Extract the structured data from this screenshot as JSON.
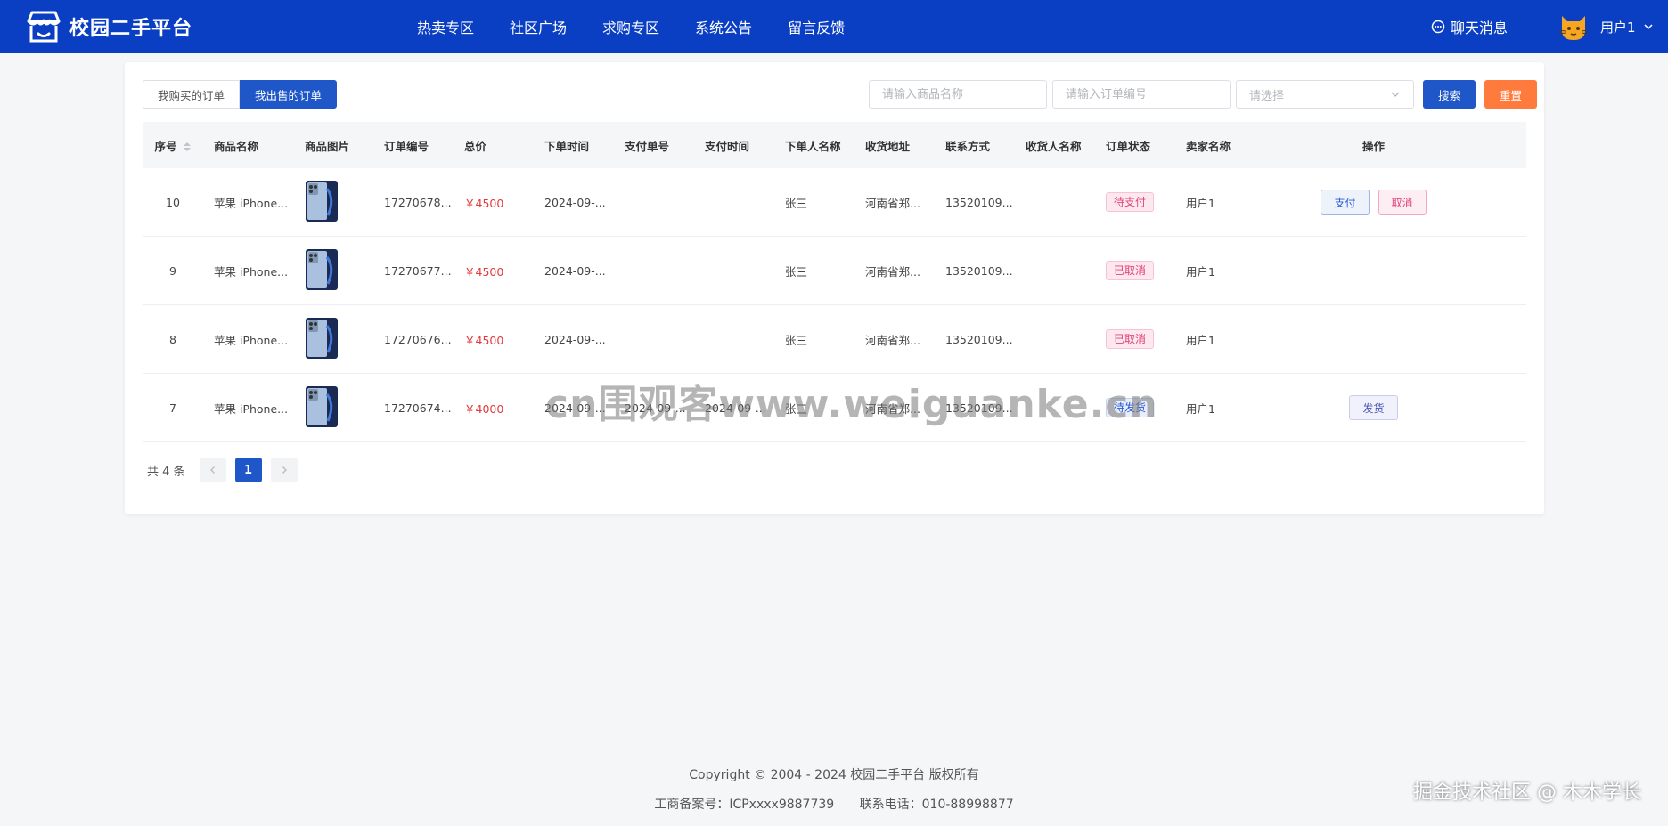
{
  "header": {
    "brand": "校园二手平台",
    "nav": [
      "热卖专区",
      "社区广场",
      "求购专区",
      "系统公告",
      "留言反馈"
    ],
    "chat_label": "聊天消息",
    "user_name": "用户1"
  },
  "tabs": [
    {
      "label": "我购买的订单",
      "active": false
    },
    {
      "label": "我出售的订单",
      "active": true
    }
  ],
  "filters": {
    "product_placeholder": "请输入商品名称",
    "order_placeholder": "请输入订单编号",
    "status_placeholder": "请选择",
    "search_label": "搜索",
    "reset_label": "重置"
  },
  "table": {
    "columns": [
      "序号",
      "商品名称",
      "商品图片",
      "订单编号",
      "总价",
      "下单时间",
      "支付单号",
      "支付时间",
      "下单人名称",
      "收货地址",
      "联系方式",
      "收货人名称",
      "订单状态",
      "卖家名称",
      "操作"
    ],
    "rows": [
      {
        "no": "10",
        "name": "苹果 iPhone...",
        "order_no": "17270678...",
        "price": "￥4500",
        "order_time": "2024-09-...",
        "pay_no": "",
        "pay_time": "",
        "buyer": "张三",
        "address": "河南省郑...",
        "phone": "13520109...",
        "receiver": "",
        "status": "待支付",
        "status_color": "pink",
        "seller": "用户1",
        "actions": [
          "支付",
          "取消"
        ]
      },
      {
        "no": "9",
        "name": "苹果 iPhone...",
        "order_no": "17270677...",
        "price": "￥4500",
        "order_time": "2024-09-...",
        "pay_no": "",
        "pay_time": "",
        "buyer": "张三",
        "address": "河南省郑...",
        "phone": "13520109...",
        "receiver": "",
        "status": "已取消",
        "status_color": "pink",
        "seller": "用户1",
        "actions": []
      },
      {
        "no": "8",
        "name": "苹果 iPhone...",
        "order_no": "17270676...",
        "price": "￥4500",
        "order_time": "2024-09-...",
        "pay_no": "",
        "pay_time": "",
        "buyer": "张三",
        "address": "河南省郑...",
        "phone": "13520109...",
        "receiver": "",
        "status": "已取消",
        "status_color": "pink",
        "seller": "用户1",
        "actions": []
      },
      {
        "no": "7",
        "name": "苹果 iPhone...",
        "order_no": "17270674...",
        "price": "￥4000",
        "order_time": "2024-09-...",
        "pay_no": "2024-09-...",
        "pay_time": "2024-09-...",
        "buyer": "张三",
        "address": "河南省郑...",
        "phone": "13520109...",
        "receiver": "",
        "status": "待发货",
        "status_color": "blue",
        "seller": "用户1",
        "actions": [
          "发货"
        ]
      }
    ]
  },
  "pagination": {
    "total_label": "共 4 条",
    "current_page": "1"
  },
  "watermark": "cn围观客www.weiguanke.cn",
  "footer": {
    "copyright": "Copyright © 2004 - 2024 校园二手平台 版权所有",
    "icp": "工商备案号：ICPxxxx9887739",
    "phone": "联系电话：010-88998877",
    "corner": "掘金技术社区 @ 木木学长"
  },
  "colors": {
    "header_bg": "#0a3fc4",
    "primary": "#1f57c8",
    "reset": "#ff7a3d",
    "price": "#e4393c"
  }
}
